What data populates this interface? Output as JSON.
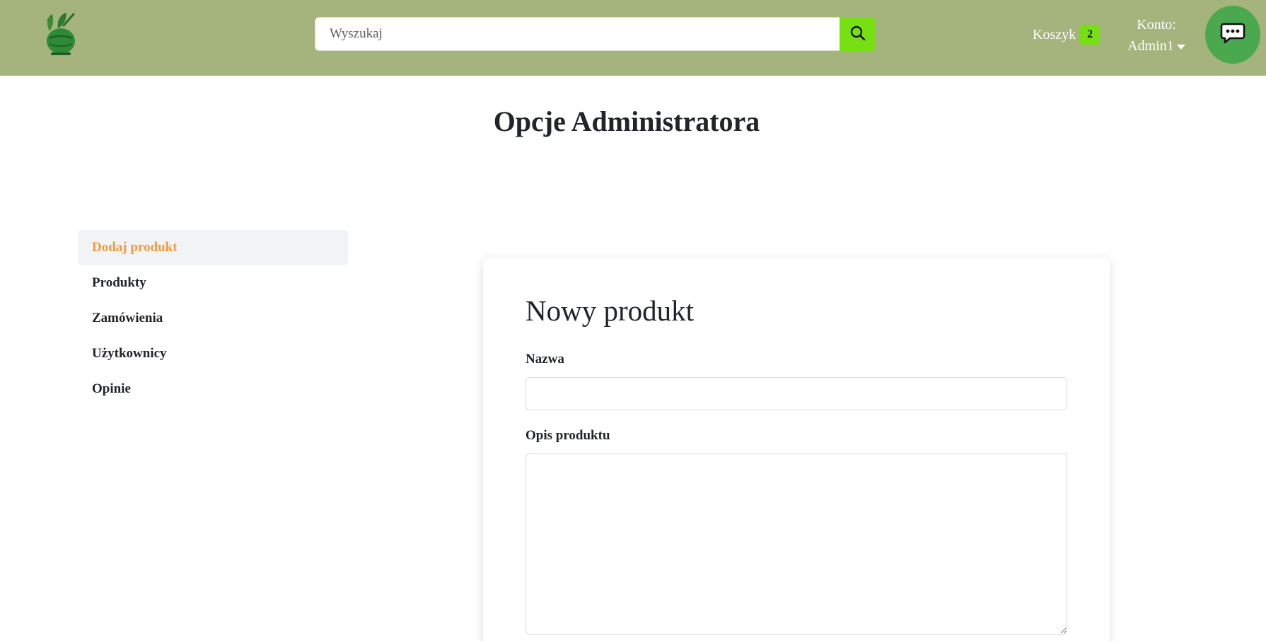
{
  "header": {
    "logo_icon": "mortar-leaf-logo",
    "search_placeholder": "Wyszukaj",
    "search_icon": "search-icon",
    "cart_label": "Koszyk",
    "cart_count": "2",
    "account_label": "Konto:",
    "account_user": "Admin1",
    "chat_icon": "chat-bubble-icon",
    "colors": {
      "bar": "#a5b37c",
      "accent": "#76e012",
      "chat": "#4aa84f"
    }
  },
  "page_title": "Opcje Administratora",
  "sidebar": {
    "items": [
      {
        "label": "Dodaj produkt",
        "active": true
      },
      {
        "label": "Produkty"
      },
      {
        "label": "Zamówienia"
      },
      {
        "label": "Użytkownicy"
      },
      {
        "label": "Opinie"
      }
    ],
    "active_color": "#f39a3a"
  },
  "form": {
    "title": "Nowy produkt",
    "name_label": "Nazwa",
    "name_value": "",
    "description_label": "Opis produktu",
    "description_value": ""
  }
}
